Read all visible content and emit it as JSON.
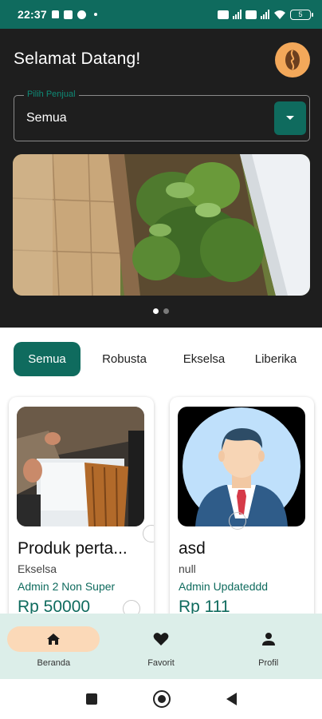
{
  "status_bar": {
    "time": "22:37",
    "battery": "5"
  },
  "header": {
    "greeting": "Selamat Datang!",
    "profile_icon": "coffee-bean-icon",
    "accent": "#f3a85a"
  },
  "seller_select": {
    "label": "Pilih Penjual",
    "value": "Semua"
  },
  "carousel": {
    "slide_count": 2,
    "active_index": 0
  },
  "categories": [
    {
      "label": "Semua",
      "active": true
    },
    {
      "label": "Robusta",
      "active": false
    },
    {
      "label": "Ekselsa",
      "active": false
    },
    {
      "label": "Liberika",
      "active": false
    }
  ],
  "products": [
    {
      "title": "Produk perta...",
      "type": "Ekselsa",
      "seller": "Admin 2 Non Super",
      "price": "Rp 50000"
    },
    {
      "title": "asd",
      "type": "null",
      "seller": "Admin Updateddd",
      "price": "Rp 111"
    }
  ],
  "bottom_nav": [
    {
      "label": "Beranda",
      "icon": "home-icon",
      "active": true
    },
    {
      "label": "Favorit",
      "icon": "heart-icon",
      "active": false
    },
    {
      "label": "Profil",
      "icon": "person-icon",
      "active": false
    }
  ],
  "colors": {
    "primary": "#0f6b5e",
    "header_bg": "#1e1e1e",
    "nav_bg": "#dceee9",
    "nav_active_pill": "#fbd9b8"
  }
}
